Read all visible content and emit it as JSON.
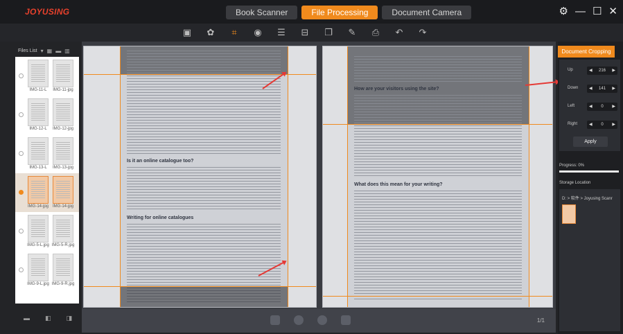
{
  "app": {
    "logo": "JOYUSING",
    "modes": [
      {
        "label": "Book Scanner",
        "active": false
      },
      {
        "label": "File Processing",
        "active": true
      },
      {
        "label": "Document Camera",
        "active": false
      }
    ],
    "window_controls": [
      "⚙",
      "—",
      "☐",
      "✕"
    ]
  },
  "toolbar": {
    "icons": [
      "image-icon",
      "color-icon",
      "crop-icon",
      "target-icon",
      "adjust-icon",
      "scan-icon",
      "copy-icon",
      "edit-icon",
      "print-icon",
      "undo-icon",
      "redo-icon"
    ]
  },
  "files": {
    "header": "Files List",
    "rows": [
      {
        "names": [
          "IMG-11-L",
          "IMG-11-jpg"
        ],
        "selected": false
      },
      {
        "names": [
          "IMG-12-L",
          "IMG-12-jpg"
        ],
        "selected": false
      },
      {
        "names": [
          "IMG-13-L",
          "IMG-13-jpg"
        ],
        "selected": false
      },
      {
        "names": [
          "IMG-14-jpg",
          "IMG-14-jpg"
        ],
        "selected": true
      },
      {
        "names": [
          "IMG-5-L.jpg",
          "IMG-5-R.jpg"
        ],
        "selected": false
      },
      {
        "names": [
          "IMG-9-L.jpg",
          "IMG-9-R.jpg"
        ],
        "selected": false
      }
    ]
  },
  "workspace": {
    "left_headings": [
      "Is it an online catalogue too?",
      "Writing for online catalogues"
    ],
    "right_headings": [
      "How are your visitors using the site?",
      "What does this mean for your writing?"
    ],
    "pager": "1/1"
  },
  "crop": {
    "button": "Document Cropping",
    "rows": [
      {
        "label": "Up",
        "value": "216"
      },
      {
        "label": "Down",
        "value": "141"
      },
      {
        "label": "Left",
        "value": "0"
      },
      {
        "label": "Right",
        "value": "0"
      }
    ],
    "apply": "Apply"
  },
  "progress": {
    "label": "Progress: 0%",
    "value": 0
  },
  "storage": {
    "label": "Storage Location",
    "path": "D: > 软件 > Joyusing Scanr"
  },
  "colors": {
    "accent": "#f08a1d",
    "arrow": "#e53935"
  }
}
